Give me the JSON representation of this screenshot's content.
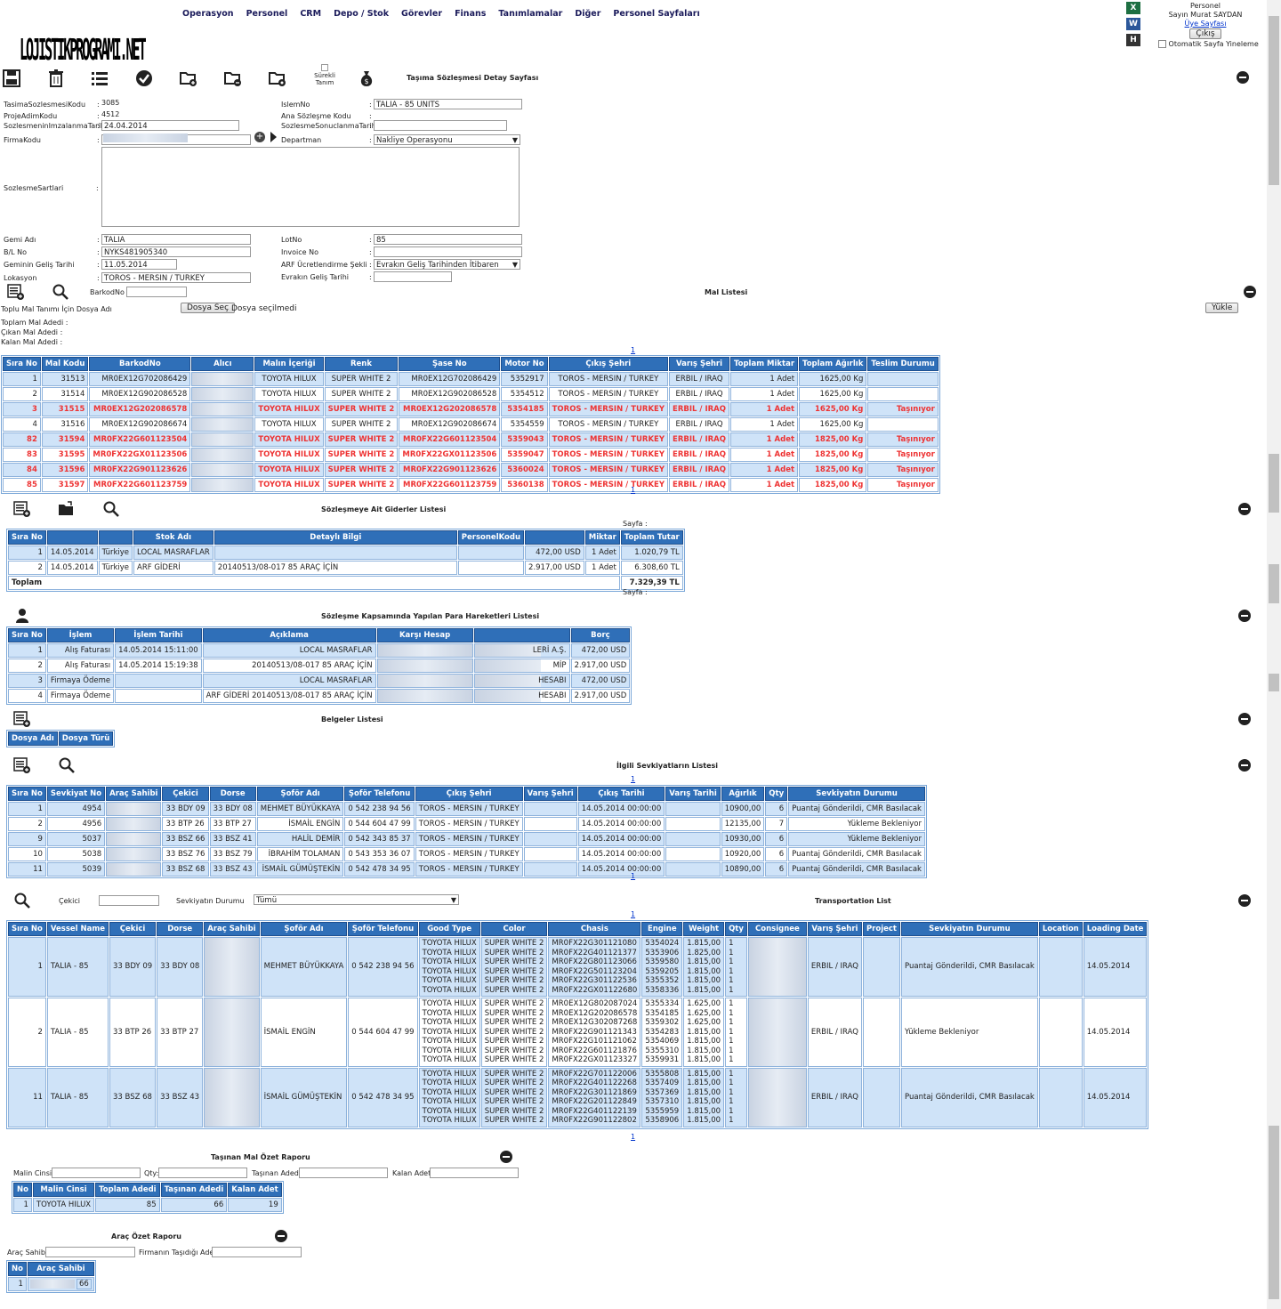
{
  "header": {
    "logo_text": "LOJISTIKPROGRAMI.NET",
    "nav": [
      "Operasyon",
      "Personel",
      "CRM",
      "Depo / Stok",
      "Görevler",
      "Finans",
      "Tanımlamalar",
      "Diğer",
      "Personel Sayfaları"
    ],
    "user_role": "Personel",
    "user_name": "Sayın Murat SAYDAN",
    "profile_link": "Üye Sayfası",
    "logout": "Çıkış",
    "auto_refresh": "Otomatik Sayfa Yineleme",
    "export_icons": [
      "excel-icon",
      "word-icon",
      "html-icon"
    ]
  },
  "toolbar": {
    "continuous_label": "Sürekli Tanım",
    "page_title": "Taşıma Sözleşmesi Detay Sayfası"
  },
  "form": {
    "left": [
      {
        "label": "TasimaSozlesmesiKodu",
        "value": "3085"
      },
      {
        "label": "ProjeAdimKodu",
        "value": "4512"
      },
      {
        "label": "SozlesmeninImzalanmaTarihi",
        "value": "24.04.2014"
      },
      {
        "label": "FirmaKodu",
        "value": ""
      }
    ],
    "right": [
      {
        "label": "IslemNo",
        "value": "TALIA - 85 UNITS"
      },
      {
        "label": "Ana Sözleşme Kodu",
        "value": ""
      },
      {
        "label": "SozlesmeSonuclanmaTarihi",
        "value": ""
      },
      {
        "label": "Departman",
        "value": "Nakliye Operasyonu"
      }
    ],
    "terms_label": "SozlesmeSartlari",
    "left2": [
      {
        "label": "Gemi Adı",
        "value": "TALIA"
      },
      {
        "label": "B/L No",
        "value": "NYKS481905340"
      },
      {
        "label": "Geminin Geliş Tarihi",
        "value": "11.05.2014"
      },
      {
        "label": "Lokasyon",
        "value": "TOROS - MERSIN / TURKEY"
      }
    ],
    "right2": [
      {
        "label": "LotNo",
        "value": "85"
      },
      {
        "label": "Invoice No",
        "value": ""
      },
      {
        "label": "ARF Ücretlendirme Şekli",
        "value": "Evrakın Geliş Tarihinden İtibaren"
      },
      {
        "label": "Evrakın Geliş Tarihi",
        "value": ""
      }
    ]
  },
  "goods": {
    "title": "Mal Listesi",
    "barcode_label": "BarkodNo :",
    "bulk_label": "Toplu Mal Tanımı İçin Dosya Adı",
    "choose_file": "Dosya Seç",
    "no_file": "Dosya seçilmedi",
    "upload": "Yükle",
    "stats": [
      "Toplam Mal Adedi :",
      "Çıkan Mal Adedi :",
      "Kalan Mal Adedi :"
    ],
    "page": "1",
    "columns": [
      "Sıra No",
      "Mal Kodu",
      "BarkodNo",
      "Alıcı",
      "Malın İçeriği",
      "Renk",
      "Şase No",
      "Motor No",
      "Çıkış Şehri",
      "Varış Şehri",
      "Toplam Miktar",
      "Toplam Ağırlık",
      "Teslim Durumu"
    ],
    "rows": [
      {
        "red": false,
        "cells": [
          "1",
          "31513",
          "MR0EX12G702086429",
          "",
          "TOYOTA HILUX",
          "SUPER WHITE 2",
          "MR0EX12G702086429",
          "5352917",
          "TOROS - MERSIN / TURKEY",
          "ERBIL / IRAQ",
          "1 Adet",
          "1625,00 Kg",
          ""
        ]
      },
      {
        "red": false,
        "cells": [
          "2",
          "31514",
          "MR0EX12G902086528",
          "",
          "TOYOTA HILUX",
          "SUPER WHITE 2",
          "MR0EX12G902086528",
          "5354512",
          "TOROS - MERSIN / TURKEY",
          "ERBIL / IRAQ",
          "1 Adet",
          "1625,00 Kg",
          ""
        ]
      },
      {
        "red": true,
        "cells": [
          "3",
          "31515",
          "MR0EX12G202086578",
          "",
          "TOYOTA HILUX",
          "SUPER WHITE 2",
          "MR0EX12G202086578",
          "5354185",
          "TOROS - MERSIN / TURKEY",
          "ERBIL / IRAQ",
          "1 Adet",
          "1625,00 Kg",
          "Taşınıyor"
        ]
      },
      {
        "red": false,
        "cells": [
          "4",
          "31516",
          "MR0EX12G902086674",
          "",
          "TOYOTA HILUX",
          "SUPER WHITE 2",
          "MR0EX12G902086674",
          "5354559",
          "TOROS - MERSIN / TURKEY",
          "ERBIL / IRAQ",
          "1 Adet",
          "1625,00 Kg",
          ""
        ]
      },
      {
        "red": true,
        "cells": [
          "82",
          "31594",
          "MR0FX22G601123504",
          "",
          "TOYOTA HILUX",
          "SUPER WHITE 2",
          "MR0FX22G601123504",
          "5359043",
          "TOROS - MERSIN / TURKEY",
          "ERBIL / IRAQ",
          "1 Adet",
          "1825,00 Kg",
          "Taşınıyor"
        ]
      },
      {
        "red": true,
        "cells": [
          "83",
          "31595",
          "MR0FX22GX01123506",
          "",
          "TOYOTA HILUX",
          "SUPER WHITE 2",
          "MR0FX22GX01123506",
          "5359047",
          "TOROS - MERSIN / TURKEY",
          "ERBIL / IRAQ",
          "1 Adet",
          "1825,00 Kg",
          "Taşınıyor"
        ]
      },
      {
        "red": true,
        "cells": [
          "84",
          "31596",
          "MR0FX22G901123626",
          "",
          "TOYOTA HILUX",
          "SUPER WHITE 2",
          "MR0FX22G901123626",
          "5360024",
          "TOROS - MERSIN / TURKEY",
          "ERBIL / IRAQ",
          "1 Adet",
          "1825,00 Kg",
          "Taşınıyor"
        ]
      },
      {
        "red": true,
        "cells": [
          "85",
          "31597",
          "MR0FX22G601123759",
          "",
          "TOYOTA HILUX",
          "SUPER WHITE 2",
          "MR0FX22G601123759",
          "5360138",
          "TOROS - MERSIN / TURKEY",
          "ERBIL / IRAQ",
          "1 Adet",
          "1825,00 Kg",
          "Taşınıyor"
        ]
      }
    ]
  },
  "expenses": {
    "title": "Sözleşmeye Ait Giderler Listesi",
    "page_label": "Sayfa :",
    "columns": [
      "Sıra No",
      "",
      "",
      "Stok Adı",
      "Detaylı Bilgi",
      "PersonelKodu",
      "",
      "Miktar",
      "Toplam Tutar"
    ],
    "rows": [
      [
        "1",
        "14.05.2014",
        "Türkiye",
        "LOCAL MASRAFLAR",
        "",
        "",
        "472,00 USD",
        "1 Adet",
        "1.020,79 TL"
      ],
      [
        "2",
        "14.05.2014",
        "Türkiye",
        "ARF GİDERİ",
        "20140513/08-017 85 ARAÇ İÇİN",
        "",
        "2.917,00 USD",
        "1 Adet",
        "6.308,60 TL"
      ]
    ],
    "total_label": "Toplam",
    "total_value": "7.329,39 TL"
  },
  "payments": {
    "title": "Sözleşme Kapsamında Yapılan Para Hareketleri Listesi",
    "columns": [
      "Sıra No",
      "İşlem",
      "İşlem Tarihi",
      "Açıklama",
      "Karşı Hesap",
      "",
      "Borç"
    ],
    "rows": [
      [
        "1",
        "Alış Faturası",
        "14.05.2014 15:11:00",
        "LOCAL MASRAFLAR",
        "",
        "LERİ A.Ş.",
        "472,00 USD"
      ],
      [
        "2",
        "Alış Faturası",
        "14.05.2014 15:19:38",
        "20140513/08-017 85 ARAÇ İÇİN",
        "",
        "MİP",
        "2.917,00 USD"
      ],
      [
        "3",
        "Firmaya Ödeme",
        "",
        "LOCAL MASRAFLAR",
        "",
        "HESABI",
        "472,00 USD"
      ],
      [
        "4",
        "Firmaya Ödeme",
        "",
        "ARF GİDERİ 20140513/08-017 85 ARAÇ İÇİN",
        "",
        "HESABI",
        "2.917,00 USD"
      ]
    ]
  },
  "documents": {
    "title": "Belgeler Listesi",
    "columns": [
      "Dosya Adı",
      "Dosya Türü"
    ]
  },
  "shipments": {
    "title": "İlgili Sevkiyatların Listesi",
    "page": "1",
    "columns": [
      "Sıra No",
      "Sevkiyat No",
      "Araç Sahibi",
      "Çekici",
      "Dorse",
      "Şoför Adı",
      "Şoför Telefonu",
      "Çıkış Şehri",
      "Varış Şehri",
      "Çıkış Tarihi",
      "Varış Tarihi",
      "Ağırlık",
      "Qty",
      "Sevkiyatın Durumu"
    ],
    "rows": [
      [
        "1",
        "4954",
        "",
        "33 BDY 09",
        "33 BDY 08",
        "MEHMET BÜYÜKKAYA",
        "0 542 238 94 56",
        "TOROS - MERSIN / TURKEY",
        "",
        "14.05.2014 00:00:00",
        "",
        "10900,00",
        "6",
        "Puantaj Gönderildi, CMR Basılacak"
      ],
      [
        "2",
        "4956",
        "",
        "33 BTP 26",
        "33 BTP 27",
        "İSMAİL ENGİN",
        "0 544 604 47 99",
        "TOROS - MERSIN / TURKEY",
        "",
        "14.05.2014 00:00:00",
        "",
        "12135,00",
        "7",
        "Yükleme Bekleniyor"
      ],
      [
        "9",
        "5037",
        "",
        "33 BSZ 66",
        "33 BSZ 41",
        "HALİL DEMİR",
        "0 542 343 85 37",
        "TOROS - MERSIN / TURKEY",
        "",
        "14.05.2014 00:00:00",
        "",
        "10930,00",
        "6",
        "Yükleme Bekleniyor"
      ],
      [
        "10",
        "5038",
        "",
        "33 BSZ 76",
        "33 BSZ 79",
        "İBRAHİM TOLAMAN",
        "0 543 353 36 07",
        "TOROS - MERSIN / TURKEY",
        "",
        "14.05.2014 00:00:00",
        "",
        "10920,00",
        "6",
        "Puantaj Gönderildi, CMR Basılacak"
      ],
      [
        "11",
        "5039",
        "",
        "33 BSZ 68",
        "33 BSZ 43",
        "İSMAİL GÜMÜŞTEKİN",
        "0 542 478 34 95",
        "TOROS - MERSIN / TURKEY",
        "",
        "14.05.2014 00:00:00",
        "",
        "10890,00",
        "6",
        "Puantaj Gönderildi, CMR Basılacak"
      ]
    ]
  },
  "transport": {
    "title": "Transportation List",
    "cekici_label": "Çekici",
    "status_label": "Sevkiyatın Durumu",
    "status_value": "Tümü",
    "page": "1",
    "columns": [
      "Sıra No",
      "Vessel Name",
      "Çekici",
      "Dorse",
      "Araç Sahibi",
      "Şoför Adı",
      "Şoför Telefonu",
      "Good Type",
      "Color",
      "Chasis",
      "Engine",
      "Weight",
      "Qty",
      "Consignee",
      "Varış Şehri",
      "Project",
      "Sevkiyatın Durumu",
      "Location",
      "Loading Date"
    ],
    "groups": [
      {
        "no": "1",
        "vessel": "TALIA - 85",
        "cekici": "33 BDY 09",
        "dorse": "33 BDY 08",
        "driver": "MEHMET BÜYÜKKAYA",
        "phone": "0 542 238 94 56",
        "city": "ERBIL / IRAQ",
        "status": "Puantaj Gönderildi, CMR Basılacak",
        "date": "14.05.2014",
        "items": [
          [
            "TOYOTA HILUX",
            "SUPER WHITE 2",
            "MR0FX22G301121080",
            "5354024",
            "1.815,00",
            "1"
          ],
          [
            "TOYOTA HILUX",
            "SUPER WHITE 2",
            "MR0FX22G401121377",
            "5353906",
            "1.825,00",
            "1"
          ],
          [
            "TOYOTA HILUX",
            "SUPER WHITE 2",
            "MR0FX22G801123066",
            "5359580",
            "1.815,00",
            "1"
          ],
          [
            "TOYOTA HILUX",
            "SUPER WHITE 2",
            "MR0FX22G501123204",
            "5359205",
            "1.815,00",
            "1"
          ],
          [
            "TOYOTA HILUX",
            "SUPER WHITE 2",
            "MR0FX22G301122536",
            "5355352",
            "1.815,00",
            "1"
          ],
          [
            "TOYOTA HILUX",
            "SUPER WHITE 2",
            "MR0FX22GX01122680",
            "5358336",
            "1.815,00",
            "1"
          ]
        ]
      },
      {
        "no": "2",
        "vessel": "TALIA - 85",
        "cekici": "33 BTP 26",
        "dorse": "33 BTP 27",
        "driver": "İSMAİL ENGİN",
        "phone": "0 544 604 47 99",
        "city": "ERBIL / IRAQ",
        "status": "Yükleme Bekleniyor",
        "date": "14.05.2014",
        "items": [
          [
            "TOYOTA HILUX",
            "SUPER WHITE 2",
            "MR0EX12G802087024",
            "5355334",
            "1.625,00",
            "1"
          ],
          [
            "TOYOTA HILUX",
            "SUPER WHITE 2",
            "MR0EX12G202086578",
            "5354185",
            "1.625,00",
            "1"
          ],
          [
            "TOYOTA HILUX",
            "SUPER WHITE 2",
            "MR0EX12G302087268",
            "5359302",
            "1.625,00",
            "1"
          ],
          [
            "TOYOTA HILUX",
            "SUPER WHITE 2",
            "MR0FX22G901121343",
            "5354283",
            "1.815,00",
            "1"
          ],
          [
            "TOYOTA HILUX",
            "SUPER WHITE 2",
            "MR0FX22G101121062",
            "5354069",
            "1.815,00",
            "1"
          ],
          [
            "TOYOTA HILUX",
            "SUPER WHITE 2",
            "MR0FX22G601121876",
            "5355310",
            "1.815,00",
            "1"
          ],
          [
            "TOYOTA HILUX",
            "SUPER WHITE 2",
            "MR0FX22GX01123327",
            "5359931",
            "1.815,00",
            "1"
          ]
        ]
      },
      {
        "no": "11",
        "vessel": "TALIA - 85",
        "cekici": "33 BSZ 68",
        "dorse": "33 BSZ 43",
        "driver": "İSMAİL GÜMÜŞTEKİN",
        "phone": "0 542 478 34 95",
        "city": "ERBIL / IRAQ",
        "status": "Puantaj Gönderildi, CMR Basılacak",
        "date": "14.05.2014",
        "items": [
          [
            "TOYOTA HILUX",
            "SUPER WHITE 2",
            "MR0FX22G701122006",
            "5355808",
            "1.815,00",
            "1"
          ],
          [
            "TOYOTA HILUX",
            "SUPER WHITE 2",
            "MR0FX22G401122268",
            "5357409",
            "1.815,00",
            "1"
          ],
          [
            "TOYOTA HILUX",
            "SUPER WHITE 2",
            "MR0FX22G301121869",
            "5357369",
            "1.815,00",
            "1"
          ],
          [
            "TOYOTA HILUX",
            "SUPER WHITE 2",
            "MR0FX22G201122849",
            "5357310",
            "1.815,00",
            "1"
          ],
          [
            "TOYOTA HILUX",
            "SUPER WHITE 2",
            "MR0FX22G401122139",
            "5355959",
            "1.815,00",
            "1"
          ],
          [
            "TOYOTA HILUX",
            "SUPER WHITE 2",
            "MR0FX22G901122802",
            "5358906",
            "1.815,00",
            "1"
          ]
        ]
      }
    ]
  },
  "goods_summary": {
    "title": "Taşınan Mal Özet Raporu",
    "filters": [
      "Malin Cinsi:",
      "Qty:",
      "Taşınan Adedi:",
      "Kalan Adet:"
    ],
    "columns": [
      "No",
      "Malin Cinsi",
      "Toplam Adedi",
      "Taşınan Adedi",
      "Kalan Adet"
    ],
    "rows": [
      [
        "1",
        "TOYOTA HILUX",
        "85",
        "66",
        "19"
      ]
    ]
  },
  "vehicle_summary": {
    "title": "Araç Özet Raporu",
    "filters": [
      "Araç Sahibi:",
      "Firmanın Taşıdığı Adet:"
    ],
    "columns": [
      "No",
      "Araç Sahibi"
    ],
    "rows": [
      [
        "1",
        "",
        "66"
      ]
    ]
  },
  "colors": {
    "header_blue": "#2f6fb8",
    "row_blue": "#cfe3f8",
    "red_text": "#e33333"
  }
}
